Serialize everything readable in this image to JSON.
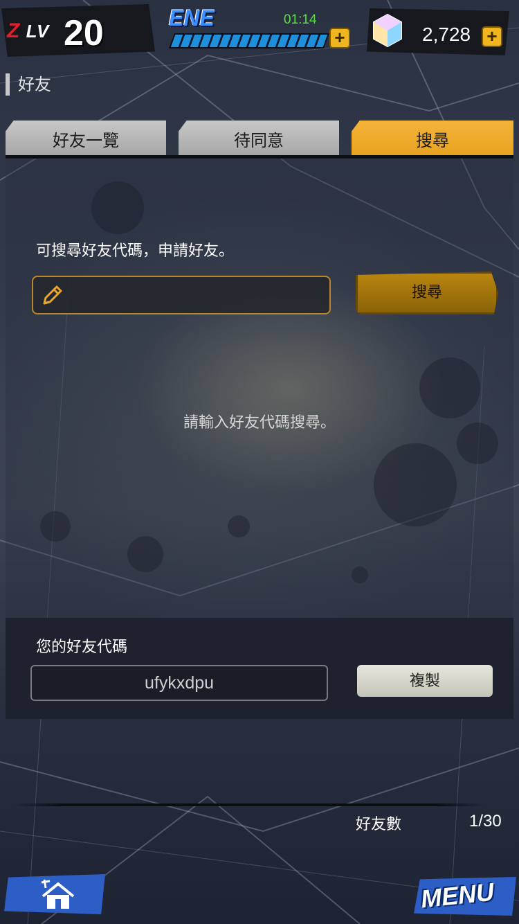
{
  "header": {
    "level_tag": "LV",
    "level_prefix": "Z",
    "level": "20",
    "energy_label": "ENE",
    "energy_timer": "01:14",
    "energy_plus": "+",
    "gems": "2,728",
    "gems_plus": "+"
  },
  "page": {
    "title": "好友"
  },
  "tabs": [
    {
      "label": "好友一覽",
      "active": false
    },
    {
      "label": "待同意",
      "active": false
    },
    {
      "label": "搜尋",
      "active": true
    }
  ],
  "search": {
    "hint": "可搜尋好友代碼，申請好友。",
    "input_value": "",
    "button_label": "搜尋",
    "empty_message": "請輸入好友代碼搜尋。"
  },
  "my_code": {
    "label": "您的好友代碼",
    "value": "ufykxdpu",
    "copy_label": "複製"
  },
  "footer": {
    "friend_count_label": "好友數",
    "friend_count_value": "1/30",
    "menu_label": "MENU"
  },
  "colors": {
    "tab_active": "#e8a21f",
    "tab_inactive": "#b4b4b4",
    "energy_timer": "#5dde41",
    "accent_blue": "#2d5ec6"
  },
  "icons": [
    "pencil-icon",
    "gem-icon",
    "plus-icon",
    "house-icon"
  ]
}
